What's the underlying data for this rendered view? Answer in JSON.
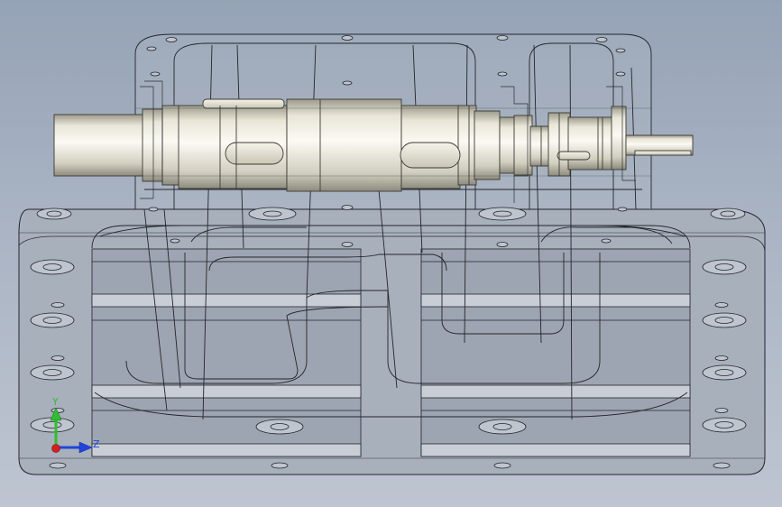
{
  "viewport": {
    "background_top": "#95a3b6",
    "background_bottom": "#bec5d1"
  },
  "model": {
    "housing_color": "#a9b1bd",
    "edge_color": "#1f2328",
    "shaft_color": "#e6e3d6"
  },
  "triad": {
    "y_label": "Y",
    "z_label": "Z",
    "y_color": "#2fbf2f",
    "z_color": "#2244dd",
    "x_color": "#d42020"
  }
}
